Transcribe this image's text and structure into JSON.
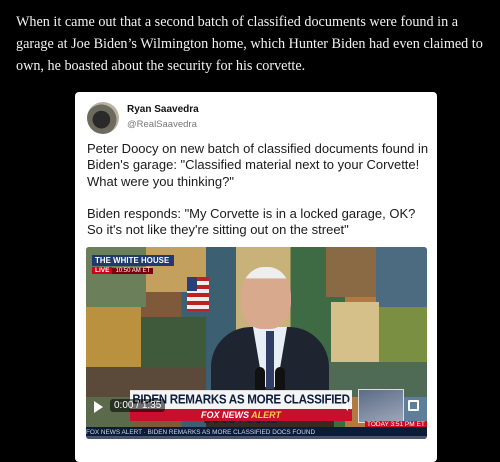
{
  "caption": "When it came out that a second batch of classified documents were found in a garage at Joe Biden’s Wilmington home, which Hunter Biden had even claimed to own, he boasted about the security for his corvette.",
  "tweet": {
    "user_name": "Ryan Saavedra",
    "handle": "@RealSaavedra",
    "paragraph_1": "Peter Doocy on new batch of classified documents found in Biden's garage: \"Classified material next to your Corvette! What were you thinking?\"",
    "paragraph_2": "Biden responds: \"My Corvette is in a locked garage, OK? So it's not like they're sitting out on the street\""
  },
  "video": {
    "overlay_top": "THE WHITE HOUSE",
    "live_label": "LIVE",
    "live_time": "10:50 AM ET",
    "headline": "BIDEN REMARKS AS MORE CLASSIFIED DOCS FOUND",
    "network_label": "FOX NEWS",
    "alert_label": "ALERT",
    "ticker": "FOX NEWS ALERT · BIDEN REMARKS AS MORE CLASSIFIED DOCS FOUND",
    "clock": "TODAY 3:51 PM ET",
    "current_time": "0:00",
    "duration": "1:35",
    "progress": 0
  },
  "icons": [
    "play-icon",
    "volume-icon",
    "fullscreen-icon",
    "avatar"
  ],
  "colors": {
    "page_bg": "#000000",
    "card_bg": "#ffffff",
    "headline_red": "#c8102e",
    "navy": "#0b1c3a"
  }
}
